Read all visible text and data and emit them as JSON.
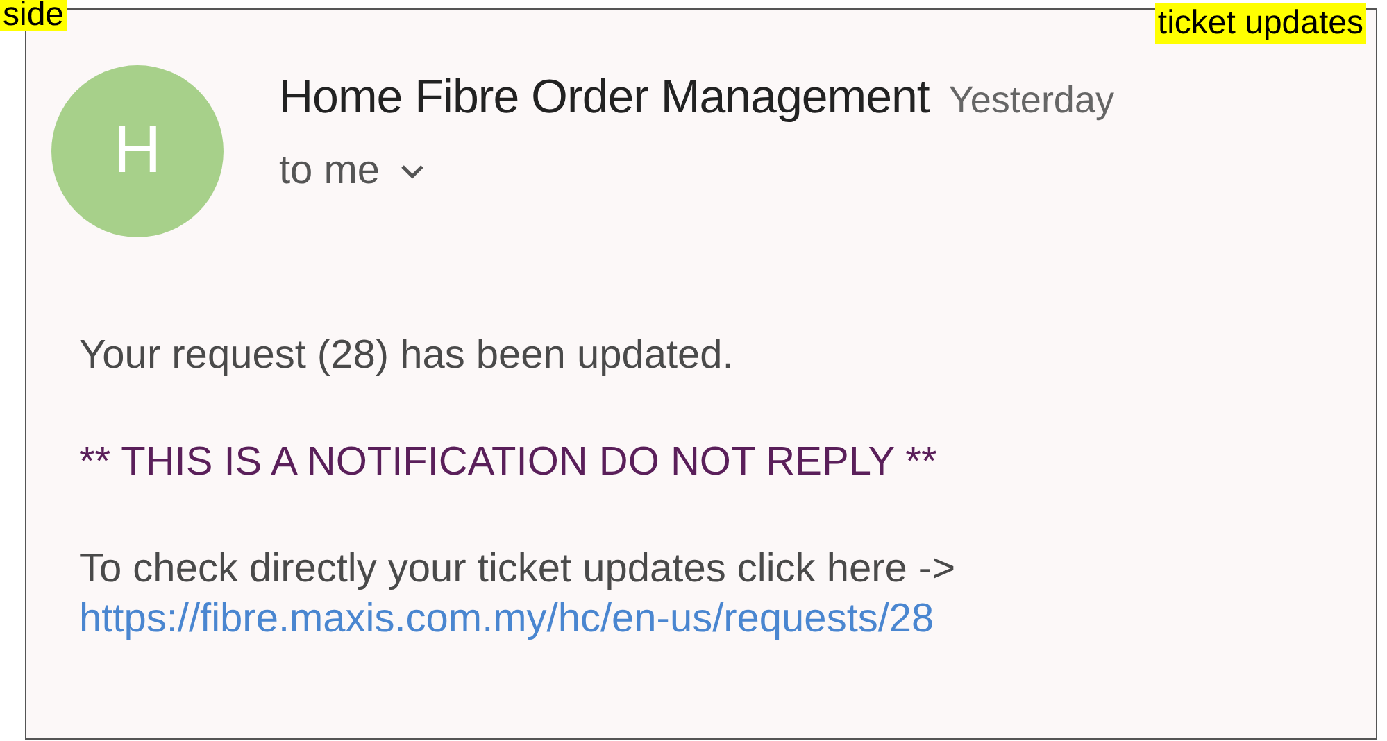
{
  "highlights": [
    {
      "text": "side"
    },
    {
      "text": "ticket updates"
    }
  ],
  "email": {
    "avatar_letter": "H",
    "sender": "Home Fibre Order Management",
    "time": "Yesterday",
    "recipient": "to me",
    "body": [
      {
        "kind": "plain",
        "text": "Your request (28) has been updated."
      },
      {
        "kind": "notice",
        "text": "** THIS IS A NOTIFICATION DO NOT REPLY **"
      },
      {
        "kind": "plain",
        "text": "To check directly your ticket updates click here ->"
      }
    ],
    "link": "https://fibre.maxis.com.my/hc/en-us/requests/28"
  }
}
